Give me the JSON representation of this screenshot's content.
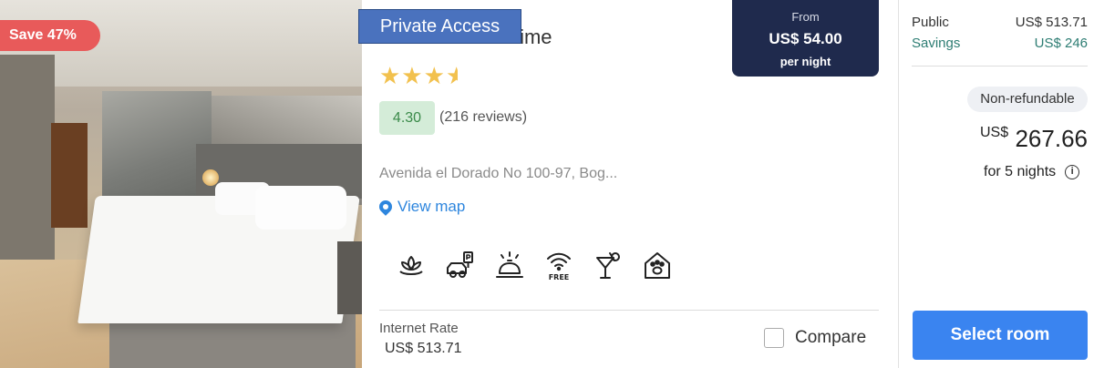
{
  "listing": {
    "save_badge": "Save 47%",
    "private_access": "Private Access",
    "hotel_name": "Hotel Habitel Prime",
    "stars": "★★★",
    "half_star": "★",
    "rating": "4.30",
    "reviews": "(216 reviews)",
    "address": "Avenida el Dorado No 100-97, Bog...",
    "view_map": "View map",
    "amenities": [
      "spa-icon",
      "parking-icon",
      "reception-bell-icon",
      "free-wifi-icon",
      "bar-cocktail-icon",
      "pet-friendly-icon"
    ],
    "internet_rate_label": "Internet Rate",
    "internet_rate_value": "US$ 513.71",
    "compare_label": "Compare"
  },
  "from_box": {
    "label": "From",
    "price": "US$ 54.00",
    "unit": "per night"
  },
  "pricing": {
    "public_label": "Public",
    "public_value": "US$ 513.71",
    "savings_label": "Savings",
    "savings_value": "US$ 246",
    "refund_badge": "Non-refundable",
    "currency": "US$",
    "total": "267.66",
    "nights": "for 5 nights",
    "info_glyph": "i",
    "select_button": "Select room"
  },
  "colors": {
    "accent": "#3a84f0",
    "save_badge": "#e85a5a",
    "rating_bg": "#d4ecd8",
    "savings_text": "#2d7d73",
    "from_box_bg": "#1f2a4d",
    "private_access_bg": "#4a72be"
  }
}
